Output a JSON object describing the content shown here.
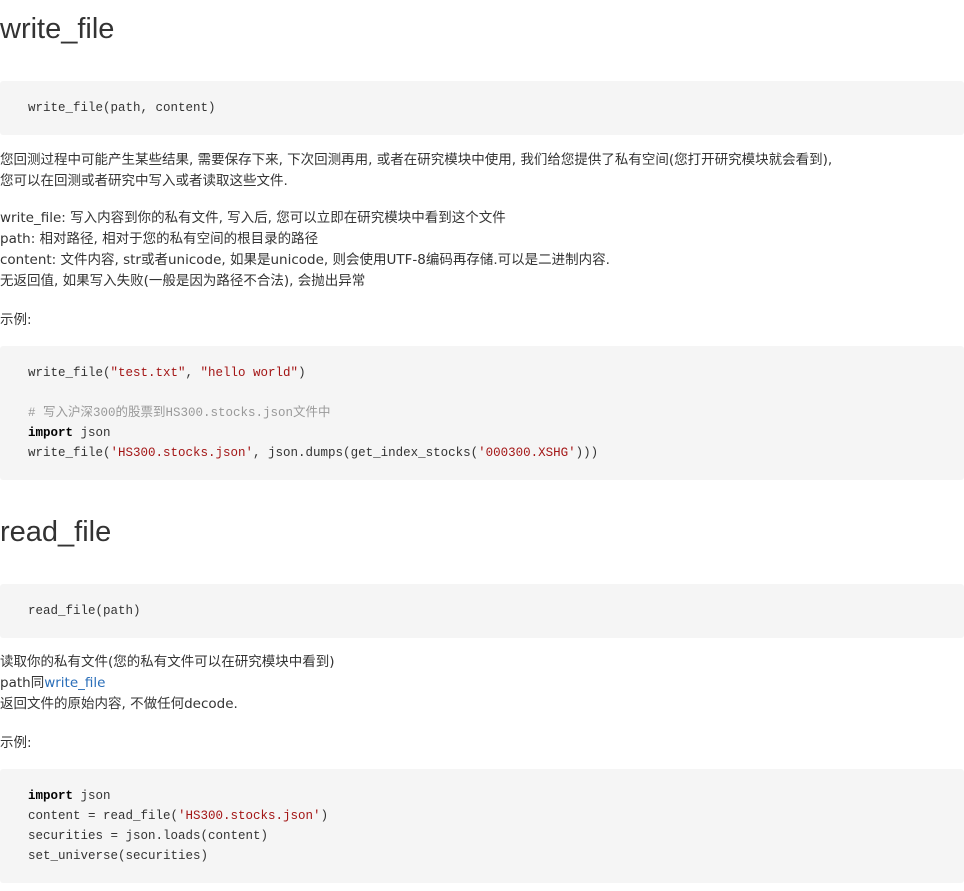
{
  "section1": {
    "title": "write_file",
    "signature": "write_file(path, content)",
    "intro": [
      "您回测过程中可能产生某些结果, 需要保存下来, 下次回测再用, 或者在研究模块中使用, 我们给您提供了私有空间(您打开研究模块就会看到),",
      "您可以在回测或者研究中写入或者读取这些文件."
    ],
    "desc": [
      "write_file: 写入内容到你的私有文件, 写入后, 您可以立即在研究模块中看到这个文件",
      "path: 相对路径, 相对于您的私有空间的根目录的路径",
      "content: 文件内容, str或者unicode, 如果是unicode, 则会使用UTF-8编码再存储.可以是二进制内容.",
      "无返回值, 如果写入失败(一般是因为路径不合法), 会抛出异常"
    ],
    "example_label": "示例:",
    "example": {
      "l1_fn": "write_file(",
      "l1_s1": "\"test.txt\"",
      "l1_sep": ", ",
      "l1_s2": "\"hello world\"",
      "l1_end": ")",
      "l3_comment": "# 写入沪深300的股票到HS300.stocks.json文件中",
      "l4_kw": "import",
      "l4_rest": " json",
      "l5_fn": "write_file(",
      "l5_s1": "'HS300.stocks.json'",
      "l5_mid": ", json.dumps(get_index_stocks(",
      "l5_s2": "'000300.XSHG'",
      "l5_end": ")))"
    }
  },
  "section2": {
    "title": "read_file",
    "signature": "read_file(path)",
    "desc1": "读取你的私有文件(您的私有文件可以在研究模块中看到)",
    "desc2_prefix": "path同",
    "desc2_link": "write_file",
    "desc3": "返回文件的原始内容, 不做任何decode.",
    "example_label": "示例:",
    "example": {
      "l1_kw": "import",
      "l1_rest": " json",
      "l2_pre": "content = read_file(",
      "l2_s": "'HS300.stocks.json'",
      "l2_end": ")",
      "l3": "securities = json.loads(content)",
      "l4": "set_universe(securities)"
    }
  }
}
